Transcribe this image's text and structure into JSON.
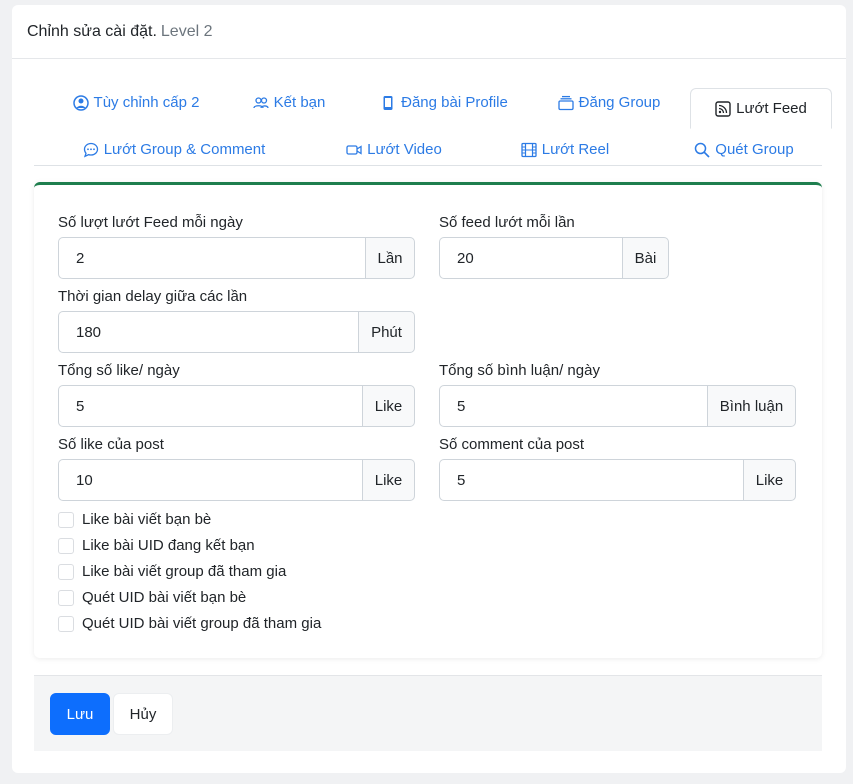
{
  "header": {
    "title": "Chỉnh sửa cài đặt.",
    "subtitle": "Level 2"
  },
  "tabs": [
    {
      "label": "Tùy chỉnh cấp 2",
      "icon": "user-circle-icon",
      "active": false
    },
    {
      "label": "Kết bạn",
      "icon": "people-icon",
      "active": false
    },
    {
      "label": "Đăng bài Profile",
      "icon": "phone-icon",
      "active": false
    },
    {
      "label": "Đăng Group",
      "icon": "collection-icon",
      "active": false
    },
    {
      "label": "Lướt Feed",
      "icon": "rss-icon",
      "active": true
    },
    {
      "label": "Lướt Group & Comment",
      "icon": "chat-dots-icon",
      "active": false
    },
    {
      "label": "Lướt Video",
      "icon": "camera-video-icon",
      "active": false
    },
    {
      "label": "Lướt Reel",
      "icon": "film-icon",
      "active": false
    },
    {
      "label": "Quét Group",
      "icon": "search-icon",
      "active": false
    }
  ],
  "fields": {
    "feed_per_day": {
      "label": "Số lượt lướt Feed mỗi ngày",
      "value": "2",
      "unit": "Lần"
    },
    "feed_per_time": {
      "label": "Số feed lướt mỗi lần",
      "value": "20",
      "unit": "Bài"
    },
    "delay": {
      "label": "Thời gian delay giữa các lần",
      "value": "180",
      "unit": "Phút"
    },
    "likes_per_day": {
      "label": "Tổng số like/ ngày",
      "value": "5",
      "unit": "Like"
    },
    "comments_per_day": {
      "label": "Tổng số bình luận/ ngày",
      "value": "5",
      "unit": "Bình luận"
    },
    "likes_per_post": {
      "label": "Số like của post",
      "value": "10",
      "unit": "Like"
    },
    "comments_per_post": {
      "label": "Số comment của post",
      "value": "5",
      "unit": "Like"
    }
  },
  "checkboxes": [
    {
      "label": "Like bài viết bạn bè",
      "checked": false
    },
    {
      "label": "Like bài UID đang kết bạn",
      "checked": false
    },
    {
      "label": "Like bài viết group đã tham gia",
      "checked": false
    },
    {
      "label": "Quét UID bài viết bạn bè",
      "checked": false
    },
    {
      "label": "Quét UID bài viết group đã tham gia",
      "checked": false
    }
  ],
  "footer": {
    "save_label": "Lưu",
    "cancel_label": "Hủy"
  },
  "colors": {
    "accent": "#2c7be5",
    "primary_button": "#0d6efd",
    "card_top_border": "#1e7e4e"
  }
}
